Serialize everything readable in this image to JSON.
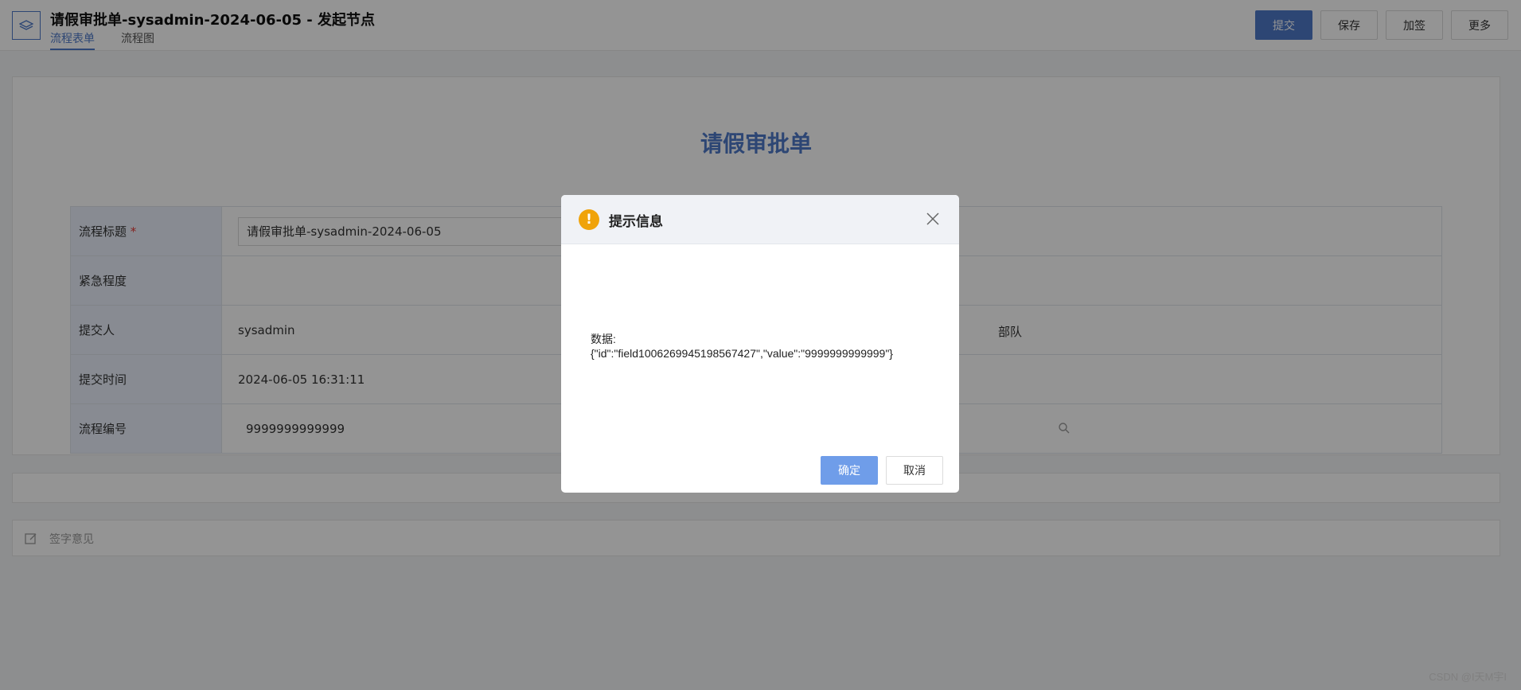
{
  "header": {
    "doc_title": "请假审批单-sysadmin-2024-06-05 - 发起节点",
    "tabs": [
      {
        "label": "流程表单",
        "active": true
      },
      {
        "label": "流程图",
        "active": false
      }
    ],
    "buttons": {
      "submit": "提交",
      "save": "保存",
      "add_sign": "加签",
      "more": "更多"
    }
  },
  "form": {
    "heading": "请假审批单",
    "rows": [
      {
        "label": "流程标题",
        "required_mark": "*",
        "value": "请假审批单-sysadmin-2024-06-05"
      },
      {
        "label": "紧急程度",
        "value": ""
      },
      {
        "label": "提交人",
        "value": "sysadmin",
        "extra_fragment": "部队"
      },
      {
        "label": "提交时间",
        "value": "2024-06-05 16:31:11"
      },
      {
        "label": "流程编号",
        "value": "9999999999999"
      }
    ]
  },
  "sign_opinion": {
    "placeholder": "签字意见"
  },
  "dialog": {
    "title": "提示信息",
    "message_line1": "数据:",
    "message_line2": "{\"id\":\"field1006269945198567427\",\"value\":\"9999999999999\"}",
    "ok_label": "确定",
    "cancel_label": "取消"
  },
  "watermark": "CSDN @I天M宇I",
  "colors": {
    "accent": "#4f79c8",
    "warning": "#f0a30a",
    "required": "#e53935"
  }
}
